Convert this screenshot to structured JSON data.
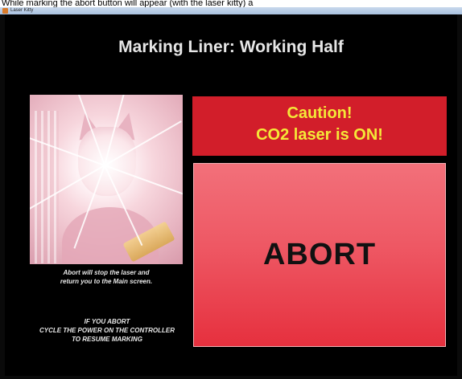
{
  "caption": "While marking the abort button will appear (with the laser kitty) a",
  "window": {
    "title": "Laser Kitty"
  },
  "screen": {
    "heading": "Marking Liner: Working Half",
    "abort_note": [
      "Abort will stop the laser and",
      "return you to the Main screen."
    ],
    "power_note": [
      "IF YOU ABORT",
      "CYCLE THE POWER ON THE CONTROLLER",
      "TO RESUME MARKING"
    ],
    "caution": [
      "Caution!",
      "CO2 laser is ON!"
    ],
    "abort_label": "ABORT"
  },
  "colors": {
    "background": "#000000",
    "caution_bg": "#d21e2a",
    "caution_text": "#f4e838",
    "abort_button": "#ee5864"
  }
}
